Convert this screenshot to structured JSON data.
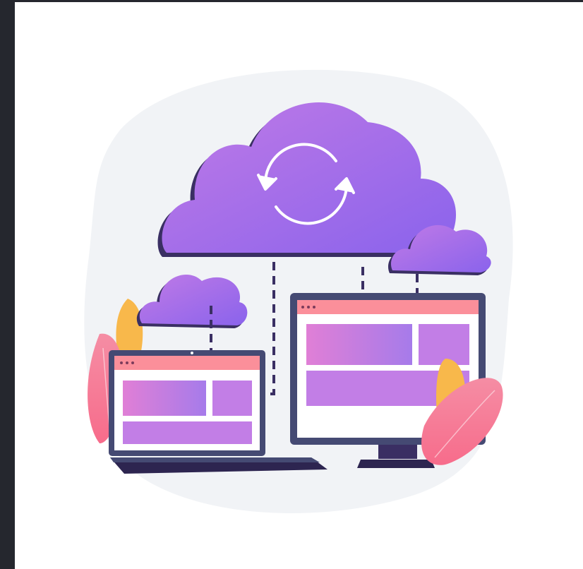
{
  "image": {
    "subject": "cloud-sync-illustration",
    "colors": {
      "page_frame": "#25272e",
      "canvas": "#ffffff",
      "backdrop_blob": "#f1f3f6",
      "cloud_purple": "#a470e8",
      "cloud_shadow": "#3a2f63",
      "screen_header": "#fb8f9a",
      "screen_panel": "#c27ee6",
      "device_frame": "#454a73",
      "foliage_pink": "#f6849a",
      "foliage_yellow": "#f8b84b"
    },
    "icons": [
      "sync-arrows-icon"
    ]
  }
}
